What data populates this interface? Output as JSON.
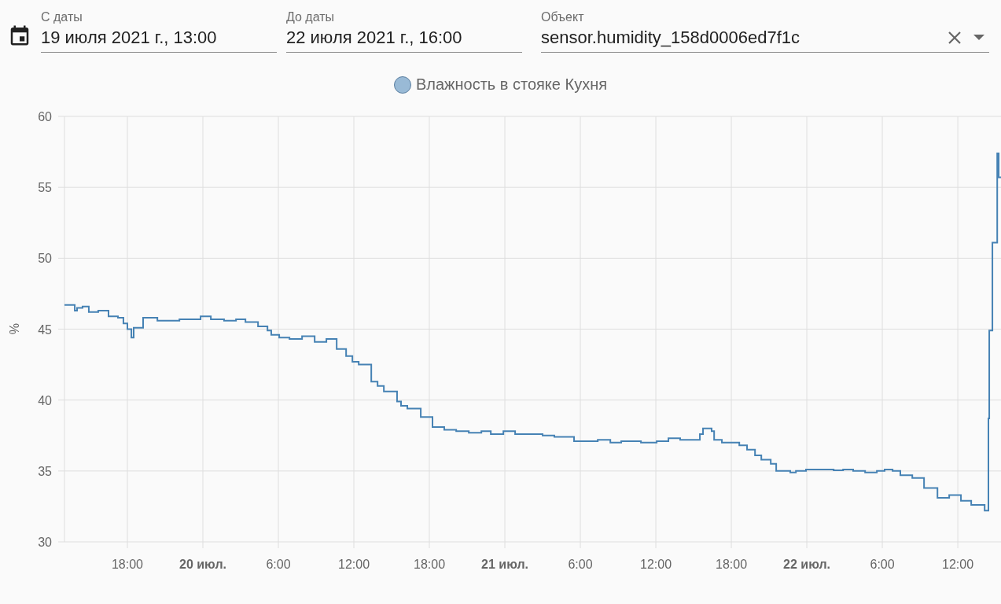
{
  "filters": [
    {
      "label": "С даты",
      "value": "19 июля 2021 г., 13:00",
      "kind": "date"
    },
    {
      "label": "До даты",
      "value": "22 июля 2021 г., 16:00",
      "kind": "date"
    },
    {
      "label": "Объект",
      "value": "sensor.humidity_158d0006ed7f1c",
      "kind": "entity"
    }
  ],
  "chart": {
    "chart_data": {
      "type": "line",
      "grid": true,
      "ylabel": "%",
      "xlim": [
        "2021-07-19T13:00",
        "2021-07-22T15:26"
      ],
      "ylim": [
        30,
        60
      ],
      "yticks": [
        30,
        35,
        40,
        45,
        50,
        55,
        60
      ],
      "xticks": [
        {
          "value": "2021-07-19T18:00",
          "label": "18:00"
        },
        {
          "value": "2021-07-20T00:00",
          "label": "20 июл."
        },
        {
          "value": "2021-07-20T06:00",
          "label": "6:00"
        },
        {
          "value": "2021-07-20T12:00",
          "label": "12:00"
        },
        {
          "value": "2021-07-20T18:00",
          "label": "18:00"
        },
        {
          "value": "2021-07-21T00:00",
          "label": "21 июл."
        },
        {
          "value": "2021-07-21T06:00",
          "label": "6:00"
        },
        {
          "value": "2021-07-21T12:00",
          "label": "12:00"
        },
        {
          "value": "2021-07-21T18:00",
          "label": "18:00"
        },
        {
          "value": "2021-07-22T00:00",
          "label": "22 июл."
        },
        {
          "value": "2021-07-22T06:00",
          "label": "6:00"
        },
        {
          "value": "2021-07-22T12:00",
          "label": "12:00"
        }
      ],
      "x": [
        "2021-07-19T13:00",
        "2021-07-19T13:49",
        "2021-07-19T13:49",
        "2021-07-19T14:00",
        "2021-07-19T14:00",
        "2021-07-19T14:26",
        "2021-07-19T14:26",
        "2021-07-19T14:56",
        "2021-07-19T14:56",
        "2021-07-19T15:41",
        "2021-07-19T15:41",
        "2021-07-19T16:30",
        "2021-07-19T16:30",
        "2021-07-19T17:15",
        "2021-07-19T17:15",
        "2021-07-19T17:41",
        "2021-07-19T17:41",
        "2021-07-19T18:00",
        "2021-07-19T18:00",
        "2021-07-19T18:19",
        "2021-07-19T18:19",
        "2021-07-19T18:30",
        "2021-07-19T18:30",
        "2021-07-19T19:15",
        "2021-07-19T19:15",
        "2021-07-19T20:23",
        "2021-07-19T20:23",
        "2021-07-19T22:08",
        "2021-07-19T22:08",
        "2021-07-19T23:49",
        "2021-07-19T23:49",
        "2021-07-20T00:38",
        "2021-07-20T00:38",
        "2021-07-20T01:41",
        "2021-07-20T01:41",
        "2021-07-20T02:38",
        "2021-07-20T02:38",
        "2021-07-20T03:23",
        "2021-07-20T03:23",
        "2021-07-20T04:23",
        "2021-07-20T04:23",
        "2021-07-20T05:08",
        "2021-07-20T05:08",
        "2021-07-20T05:26",
        "2021-07-20T05:26",
        "2021-07-20T06:04",
        "2021-07-20T06:04",
        "2021-07-20T06:53",
        "2021-07-20T06:53",
        "2021-07-20T07:53",
        "2021-07-20T07:53",
        "2021-07-20T08:53",
        "2021-07-20T08:53",
        "2021-07-20T09:49",
        "2021-07-20T09:49",
        "2021-07-20T10:38",
        "2021-07-20T10:38",
        "2021-07-20T11:23",
        "2021-07-20T11:23",
        "2021-07-20T11:53",
        "2021-07-20T11:53",
        "2021-07-20T12:23",
        "2021-07-20T12:23",
        "2021-07-20T13:23",
        "2021-07-20T13:23",
        "2021-07-20T13:53",
        "2021-07-20T13:53",
        "2021-07-20T14:23",
        "2021-07-20T14:23",
        "2021-07-20T15:26",
        "2021-07-20T15:26",
        "2021-07-20T15:45",
        "2021-07-20T15:45",
        "2021-07-20T16:15",
        "2021-07-20T16:15",
        "2021-07-20T17:19",
        "2021-07-20T17:19",
        "2021-07-20T18:15",
        "2021-07-20T18:15",
        "2021-07-20T19:11",
        "2021-07-20T19:11",
        "2021-07-20T20:08",
        "2021-07-20T20:08",
        "2021-07-20T21:08",
        "2021-07-20T21:08",
        "2021-07-20T22:08",
        "2021-07-20T22:08",
        "2021-07-20T22:53",
        "2021-07-20T22:53",
        "2021-07-20T23:53",
        "2021-07-20T23:53",
        "2021-07-21T00:49",
        "2021-07-21T00:49",
        "2021-07-21T03:00",
        "2021-07-21T03:00",
        "2021-07-21T03:56",
        "2021-07-21T03:56",
        "2021-07-21T05:30",
        "2021-07-21T05:30",
        "2021-07-21T07:23",
        "2021-07-21T07:23",
        "2021-07-21T08:23",
        "2021-07-21T08:23",
        "2021-07-21T09:15",
        "2021-07-21T09:15",
        "2021-07-21T10:49",
        "2021-07-21T10:49",
        "2021-07-21T12:04",
        "2021-07-21T12:04",
        "2021-07-21T13:00",
        "2021-07-21T13:00",
        "2021-07-21T13:56",
        "2021-07-21T13:56",
        "2021-07-21T15:30",
        "2021-07-21T15:30",
        "2021-07-21T15:45",
        "2021-07-21T15:45",
        "2021-07-21T16:26",
        "2021-07-21T16:26",
        "2021-07-21T16:38",
        "2021-07-21T16:38",
        "2021-07-21T17:15",
        "2021-07-21T17:15",
        "2021-07-21T18:38",
        "2021-07-21T18:38",
        "2021-07-21T19:15",
        "2021-07-21T19:15",
        "2021-07-21T19:53",
        "2021-07-21T19:53",
        "2021-07-21T20:23",
        "2021-07-21T20:23",
        "2021-07-21T21:08",
        "2021-07-21T21:08",
        "2021-07-21T21:34",
        "2021-07-21T21:34",
        "2021-07-21T22:41",
        "2021-07-21T22:41",
        "2021-07-21T23:08",
        "2021-07-21T23:08",
        "2021-07-21T23:56",
        "2021-07-21T23:56",
        "2021-07-22T02:08",
        "2021-07-22T02:08",
        "2021-07-22T02:53",
        "2021-07-22T02:53",
        "2021-07-22T03:41",
        "2021-07-22T03:41",
        "2021-07-22T04:38",
        "2021-07-22T04:38",
        "2021-07-22T05:34",
        "2021-07-22T05:34",
        "2021-07-22T06:11",
        "2021-07-22T06:11",
        "2021-07-22T06:49",
        "2021-07-22T06:49",
        "2021-07-22T07:26",
        "2021-07-22T07:26",
        "2021-07-22T08:23",
        "2021-07-22T08:23",
        "2021-07-22T09:19",
        "2021-07-22T09:19",
        "2021-07-22T10:23",
        "2021-07-22T10:23",
        "2021-07-22T11:19",
        "2021-07-22T11:19",
        "2021-07-22T12:15",
        "2021-07-22T12:15",
        "2021-07-22T13:04",
        "2021-07-22T13:04",
        "2021-07-22T14:08",
        "2021-07-22T14:08",
        "2021-07-22T14:26",
        "2021-07-22T14:26",
        "2021-07-22T14:30",
        "2021-07-22T14:30",
        "2021-07-22T14:45",
        "2021-07-22T14:45",
        "2021-07-22T15:08",
        "2021-07-22T15:08",
        "2021-07-22T15:15",
        "2021-07-22T15:15",
        "2021-07-22T15:26"
      ],
      "series": [
        {
          "name": "Влажность в стояке Кухня",
          "color": "#4682b4",
          "values": [
            46.7,
            46.7,
            46.3,
            46.3,
            46.5,
            46.5,
            46.6,
            46.6,
            46.2,
            46.2,
            46.3,
            46.3,
            45.9,
            45.9,
            45.8,
            45.8,
            45.4,
            45.4,
            45.0,
            45.0,
            44.4,
            44.4,
            45.1,
            45.1,
            45.8,
            45.8,
            45.6,
            45.6,
            45.7,
            45.7,
            45.9,
            45.9,
            45.7,
            45.7,
            45.6,
            45.6,
            45.7,
            45.7,
            45.5,
            45.5,
            45.2,
            45.2,
            44.9,
            44.9,
            44.6,
            44.6,
            44.4,
            44.4,
            44.3,
            44.3,
            44.5,
            44.5,
            44.1,
            44.1,
            44.3,
            44.3,
            43.6,
            43.6,
            43.1,
            43.1,
            42.7,
            42.7,
            42.5,
            42.5,
            41.3,
            41.3,
            41.0,
            41.0,
            40.6,
            40.6,
            39.9,
            39.9,
            39.6,
            39.6,
            39.4,
            39.4,
            38.8,
            38.8,
            38.1,
            38.1,
            37.9,
            37.9,
            37.8,
            37.8,
            37.7,
            37.7,
            37.8,
            37.8,
            37.6,
            37.6,
            37.8,
            37.8,
            37.6,
            37.6,
            37.5,
            37.5,
            37.4,
            37.4,
            37.1,
            37.1,
            37.2,
            37.2,
            37.0,
            37.0,
            37.1,
            37.1,
            37.0,
            37.0,
            37.1,
            37.1,
            37.3,
            37.3,
            37.2,
            37.2,
            37.6,
            37.6,
            38.0,
            38.0,
            37.8,
            37.8,
            37.2,
            37.2,
            37.0,
            37.0,
            36.8,
            36.8,
            36.5,
            36.5,
            36.1,
            36.1,
            35.8,
            35.8,
            35.5,
            35.5,
            35.0,
            35.0,
            34.9,
            34.9,
            35.0,
            35.0,
            35.1,
            35.1,
            35.05,
            35.05,
            35.1,
            35.1,
            35.0,
            35.0,
            34.9,
            34.9,
            35.0,
            35.0,
            35.1,
            35.1,
            35.0,
            35.0,
            34.7,
            34.7,
            34.5,
            34.5,
            33.8,
            33.8,
            33.1,
            33.1,
            33.3,
            33.3,
            32.9,
            32.9,
            32.6,
            32.6,
            32.2,
            32.2,
            38.7,
            38.7,
            44.9,
            44.9,
            51.1,
            51.1,
            57.4,
            57.4,
            55.7,
            55.7
          ]
        }
      ]
    }
  }
}
